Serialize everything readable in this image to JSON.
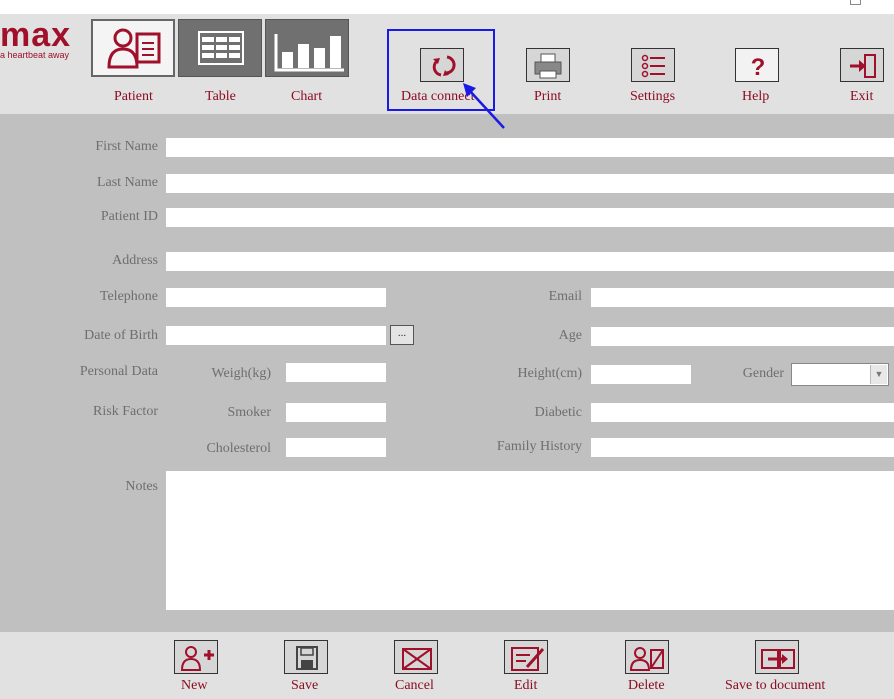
{
  "brand": {
    "name": "max",
    "tagline": "a heartbeat away"
  },
  "toolbar": {
    "items": [
      {
        "label": "Patient"
      },
      {
        "label": "Table"
      },
      {
        "label": "Chart"
      },
      {
        "label": "Data connect"
      },
      {
        "label": "Print"
      },
      {
        "label": "Settings"
      },
      {
        "label": "Help"
      },
      {
        "label": "Exit"
      }
    ]
  },
  "form": {
    "first_name": {
      "label": "First Name",
      "value": ""
    },
    "last_name": {
      "label": "Last Name",
      "value": ""
    },
    "patient_id": {
      "label": "Patient ID",
      "value": ""
    },
    "address": {
      "label": "Address",
      "value": ""
    },
    "telephone": {
      "label": "Telephone",
      "value": ""
    },
    "email": {
      "label": "Email",
      "value": ""
    },
    "date_of_birth": {
      "label": "Date of Birth",
      "value": "",
      "picker_label": "..."
    },
    "age": {
      "label": "Age",
      "value": ""
    },
    "personal_data": {
      "label": "Personal Data"
    },
    "weight": {
      "label": "Weigh(kg)",
      "value": ""
    },
    "height": {
      "label": "Height(cm)",
      "value": ""
    },
    "gender": {
      "label": "Gender",
      "value": ""
    },
    "risk_factor": {
      "label": "Risk Factor"
    },
    "smoker": {
      "label": "Smoker",
      "value": ""
    },
    "diabetic": {
      "label": "Diabetic",
      "value": ""
    },
    "cholesterol": {
      "label": "Cholesterol",
      "value": ""
    },
    "family_history": {
      "label": "Family History",
      "value": ""
    },
    "notes": {
      "label": "Notes",
      "value": ""
    }
  },
  "actions": [
    {
      "label": "New"
    },
    {
      "label": "Save"
    },
    {
      "label": "Cancel"
    },
    {
      "label": "Edit"
    },
    {
      "label": "Delete"
    },
    {
      "label": "Save to document"
    }
  ],
  "colors": {
    "accent": "#8b0d21",
    "highlight": "#1a1ae6",
    "panel": "#c0c0c0",
    "toolbar": "#e1e1e1"
  }
}
